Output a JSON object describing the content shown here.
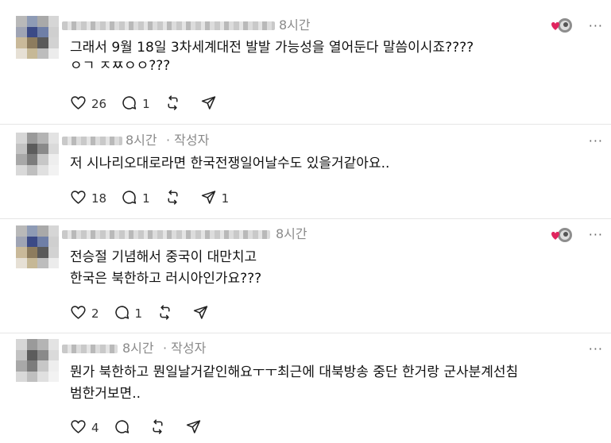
{
  "colors": {
    "heart_badge": "#e0245e",
    "meta_text": "#8a8a8a"
  },
  "icons": {
    "like": "heart-icon",
    "reply": "comment-icon",
    "repost": "repost-icon",
    "share": "send-icon",
    "more": "more-icon"
  },
  "posts": [
    {
      "time": "8시간",
      "author_tag": "",
      "lines": [
        "그래서 9월 18일 3차세계대전 발발 가능성을 열어둔다 말씀이시죠????",
        "ㅇㄱ ㅈㅉㅇㅇ???"
      ],
      "likes": "26",
      "replies": "1",
      "reposts": "",
      "shares": "",
      "more": "···"
    },
    {
      "time": "8시간",
      "author_tag": "· 작성자",
      "lines": [
        "저 시나리오대로라면 한국전쟁일어날수도 있을거같아요.."
      ],
      "likes": "18",
      "replies": "1",
      "reposts": "",
      "shares": "1",
      "more": "···"
    },
    {
      "time": "8시간",
      "author_tag": "",
      "lines": [
        "전승절 기념해서 중국이 대만치고",
        "한국은 북한하고 러시아인가요???"
      ],
      "likes": "2",
      "replies": "1",
      "reposts": "",
      "shares": "",
      "more": "···"
    },
    {
      "time": "8시간",
      "author_tag": "· 작성자",
      "lines": [
        "뭔가 북한하고 뭔일날거같인해요ㅜㅜ최근에 대북방송 중단 한거랑 군사분계선침",
        "범한거보면.."
      ],
      "likes": "4",
      "replies": "",
      "reposts": "",
      "shares": "",
      "more": "···"
    }
  ]
}
